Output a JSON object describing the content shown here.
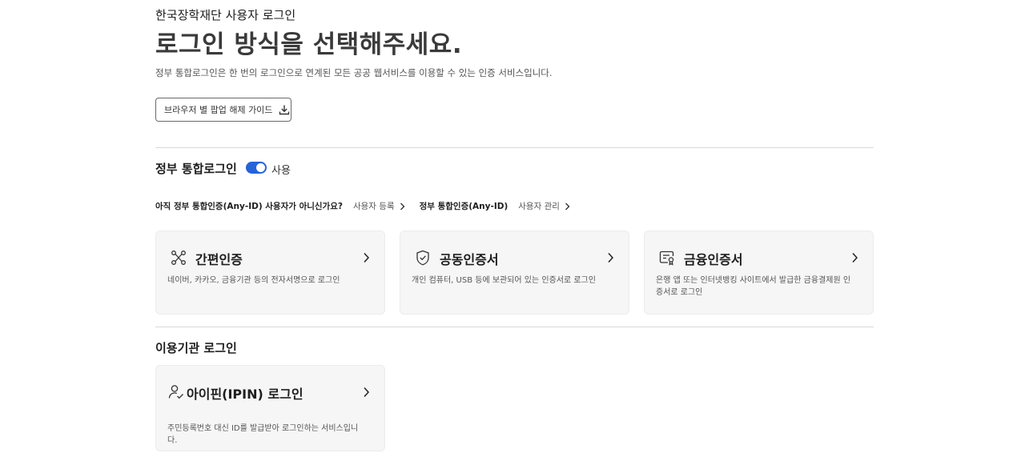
{
  "header": {
    "org_title": "한국장학재단 사용자 로그인",
    "main_title": "로그인 방식을 선택해주세요.",
    "description": "정부 통합로그인은 한 번의 로그인으로 연계된 모든 공공 웹서비스를 이용할 수 있는 인증 서비스입니다.",
    "guide_button": "브라우저 별 팝업 해제 가이드",
    "guide_icon": "download-icon"
  },
  "gov_login": {
    "title": "정부 통합로그인",
    "toggle_label": "사용",
    "toggle_on": true,
    "toggle_color": "#2563d8",
    "question": "아직 정부 통합인증(Any-ID) 사용자가 아니신가요?",
    "register_link": "사용자 등록",
    "anyid_label": "정부 통합인증(Any-ID)",
    "manage_link": "사용자 관리",
    "cards": [
      {
        "title": "간편인증",
        "icon": "simple-auth-icon",
        "desc": "네이버, 카카오, 금융기관 등의 전자서명으로 로그인"
      },
      {
        "title": "공동인증서",
        "icon": "shield-check-icon",
        "desc": "개인 컴퓨터, USB 등에 보관되어 있는 인증서로 로그인"
      },
      {
        "title": "금융인증서",
        "icon": "certificate-icon",
        "desc": "은행 앱 또는 인터넷뱅킹 사이트에서 발급한 금융결제원 인증서로 로그인"
      }
    ]
  },
  "agency_login": {
    "title": "이용기관 로그인",
    "cards": [
      {
        "title": "아이핀(IPIN) 로그인",
        "icon": "user-check-icon",
        "desc": "주민등록번호 대신 ID를 발급받아 로그인하는 서비스입니다."
      }
    ]
  }
}
